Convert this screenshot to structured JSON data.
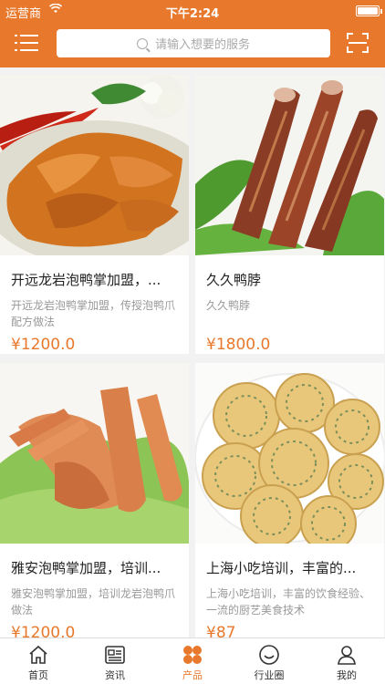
{
  "status_bar": {
    "carrier": "运营商",
    "time": "下午2:24"
  },
  "header": {
    "search_placeholder": "请输入想要的服务"
  },
  "colors": {
    "accent": "#e8792c",
    "price": "#e8792c"
  },
  "products": [
    {
      "title": "开远龙岩泡鸭掌加盟，...",
      "desc": "开远龙岩泡鸭掌加盟，传授泡鸭爪配方做法",
      "price": "¥1200.0"
    },
    {
      "title": "久久鸭脖",
      "desc": "久久鸭脖",
      "price": "¥1800.0"
    },
    {
      "title": "雅安泡鸭掌加盟，培训...",
      "desc": "雅安泡鸭掌加盟，培训龙岩泡鸭爪做法",
      "price": "¥1200.0"
    },
    {
      "title": "上海小吃培训，丰富的...",
      "desc": "上海小吃培训，丰富的饮食经验、一流的厨艺美食技术",
      "price": "¥87"
    }
  ],
  "tabbar": {
    "items": [
      {
        "label": "首页",
        "icon": "home-icon"
      },
      {
        "label": "资讯",
        "icon": "news-icon"
      },
      {
        "label": "产品",
        "icon": "products-icon",
        "active": true
      },
      {
        "label": "行业圈",
        "icon": "circle-icon"
      },
      {
        "label": "我的",
        "icon": "user-icon"
      }
    ]
  }
}
